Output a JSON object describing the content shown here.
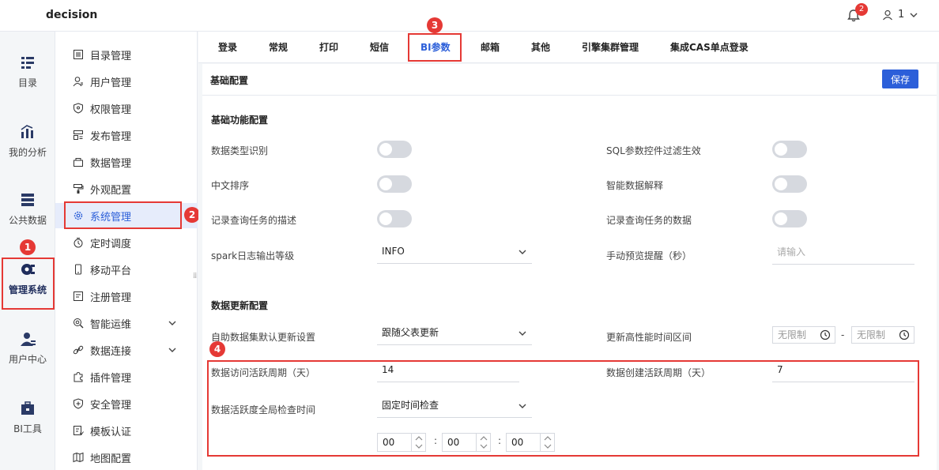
{
  "app": {
    "title": "decision",
    "notifications": "2",
    "user": "1"
  },
  "rail": [
    {
      "label": "目录",
      "icon": "directory-icon"
    },
    {
      "label": "我的分析",
      "icon": "analysis-icon"
    },
    {
      "label": "公共数据",
      "icon": "public-data-icon"
    },
    {
      "label": "管理系统",
      "icon": "manage-system-icon"
    },
    {
      "label": "用户中心",
      "icon": "user-center-icon"
    },
    {
      "label": "BI工具",
      "icon": "bi-tools-icon"
    }
  ],
  "submenu": [
    {
      "label": "目录管理"
    },
    {
      "label": "用户管理"
    },
    {
      "label": "权限管理"
    },
    {
      "label": "发布管理"
    },
    {
      "label": "数据管理"
    },
    {
      "label": "外观配置"
    },
    {
      "label": "系统管理"
    },
    {
      "label": "定时调度"
    },
    {
      "label": "移动平台"
    },
    {
      "label": "注册管理"
    },
    {
      "label": "智能运维"
    },
    {
      "label": "数据连接"
    },
    {
      "label": "插件管理"
    },
    {
      "label": "安全管理"
    },
    {
      "label": "模板认证"
    },
    {
      "label": "地图配置"
    }
  ],
  "tabs": [
    "登录",
    "常规",
    "打印",
    "短信",
    "BI参数",
    "邮箱",
    "其他",
    "引擎集群管理",
    "集成CAS单点登录"
  ],
  "steps": [
    "1",
    "2",
    "3",
    "4"
  ],
  "panel": {
    "title": "基础配置",
    "save": "保存",
    "basic_section": "基础功能配置",
    "data_type": "数据类型识别",
    "sql_filter": "SQL参数控件过滤生效",
    "cn_sort": "中文排序",
    "smart_explain": "智能数据解释",
    "record_desc": "记录查询任务的描述",
    "record_data": "记录查询任务的数据",
    "spark_level": "spark日志输出等级",
    "spark_value": "INFO",
    "preview_remind": "手动预览提醒（秒）",
    "preview_placeholder": "请输入",
    "update_section": "数据更新配置",
    "self_update": "自助数据集默认更新设置",
    "self_update_value": "跟随父表更新",
    "hp_range": "更新高性能时间区间",
    "no_limit": "无限制",
    "range_dash": "-",
    "visit_period": "数据访问活跃周期（天）",
    "visit_value": "14",
    "create_period": "数据创建活跃周期（天）",
    "create_value": "7",
    "global_check": "数据活跃度全局检查时间",
    "global_check_value": "固定时间检查",
    "hour": "00",
    "minute": "00",
    "second": "00",
    "colon": ":"
  }
}
